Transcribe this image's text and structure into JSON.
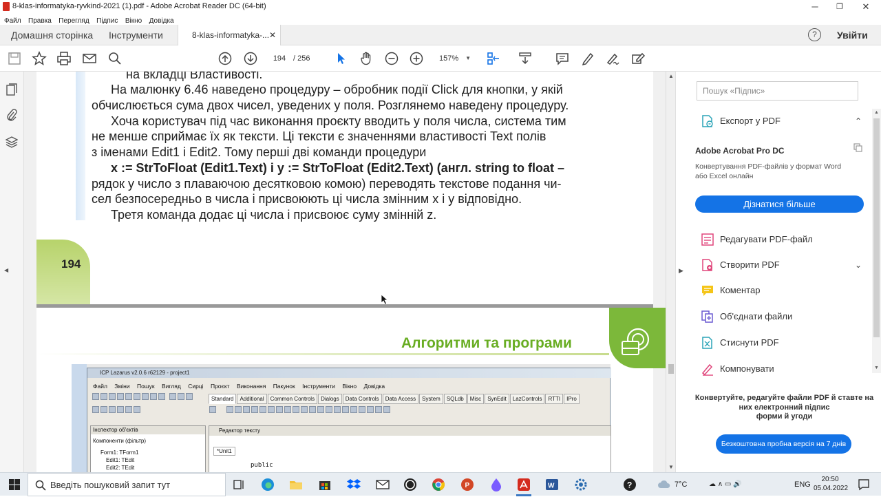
{
  "window": {
    "title": "8-klas-informatyka-ryvkind-2021 (1).pdf - Adobe Acrobat Reader DC (64-bit)",
    "minimize": "─",
    "maximize": "❐",
    "close": "✕"
  },
  "menu": [
    "Файл",
    "Правка",
    "Перегляд",
    "Підпис",
    "Вікно",
    "Довідка"
  ],
  "tabs": {
    "home": "Домашня сторінка",
    "tools": "Інструменти",
    "document": "8-klas-informatyka-...",
    "close": "✕",
    "help": "?",
    "signin": "Увійти"
  },
  "toolbar": {
    "page_current": "194",
    "page_total": "/ 256",
    "zoom": "157%"
  },
  "document": {
    "page1_lines": [
      "на вкладці Властивості.",
      "На малюнку 6.46 наведено процедуру – обробник події Click для кнопки, у якій",
      "обчислюється сума двох чисел, уведених у поля. Розглянемо наведену процедуру.",
      "Хоча користувач під час виконання проєкту вводить у поля числа, система тим",
      "не менше сприймає їх як тексти. Ці тексти є значеннями властивості Text полів",
      "з іменами Edit1 і Edit2. Тому перші дві команди процедури",
      "x := StrToFloat (Edit1.Text) і y := StrToFloat (Edit2.Text) (англ. string to float –",
      "рядок у число з плаваючою десятковою комою) переводять текстове подання чи-",
      "сел безпосередньо в числа і присвоюють ці числа змінним x і y відповідно.",
      "Третя команда додає ці числа і присвоює суму змінній z."
    ],
    "page_number": "194",
    "page2_heading": "Алгоритми та програми",
    "lazarus": {
      "title": "ICP Lazarus v2.0.6 r62129 - project1",
      "menu": [
        "Файл",
        "Зміни",
        "Пошук",
        "Вигляд",
        "Сирці",
        "Проєкт",
        "Виконання",
        "Пакунок",
        "Інструменти",
        "Вікно",
        "Довідка"
      ],
      "component_tabs": [
        "Standard",
        "Additional",
        "Common Controls",
        "Dialogs",
        "Data Controls",
        "Data Access",
        "System",
        "SQLdb",
        "Misc",
        "SynEdit",
        "LazControls",
        "RTTI",
        "IPro"
      ],
      "inspector_title": "Інспектор об'єктів",
      "inspector_filter": "Компоненти   (фільтр)",
      "inspector_rows": [
        "Form1: TForm1",
        "Edit1: TEdit",
        "Edit2: TEdit"
      ],
      "editor_title": "Редактор тексту",
      "editor_tab": "*Unit1",
      "code": "public"
    }
  },
  "right_panel": {
    "search_placeholder": "Пошук «Підпис»",
    "export_pdf": "Експорт у PDF",
    "promo_title": "Adobe Acrobat Pro DC",
    "promo_desc": "Конвертування PDF-файлів у формат Word або Excel онлайн",
    "promo_button": "Дізнатися більше",
    "items": [
      "Редагувати PDF-файл",
      "Створити PDF",
      "Коментар",
      "Об'єднати файли",
      "Стиснути PDF",
      "Компонувати"
    ],
    "bottom_text_1": "Конвертуйте, редагуйте файли PDF й ставте на них електронний підпис",
    "bottom_text_2": "форми й угоди",
    "trial_button": "Безкоштовна пробна версія на 7 днів"
  },
  "taskbar": {
    "search_placeholder": "Введіть пошуковий запит тут",
    "weather": "7°C",
    "language": "ENG",
    "time": "20:50",
    "date": "05.04.2022"
  },
  "colors": {
    "adobe_red": "#d42b1e",
    "accent_blue": "#1473e6",
    "chapter_green": "#68ad22"
  }
}
